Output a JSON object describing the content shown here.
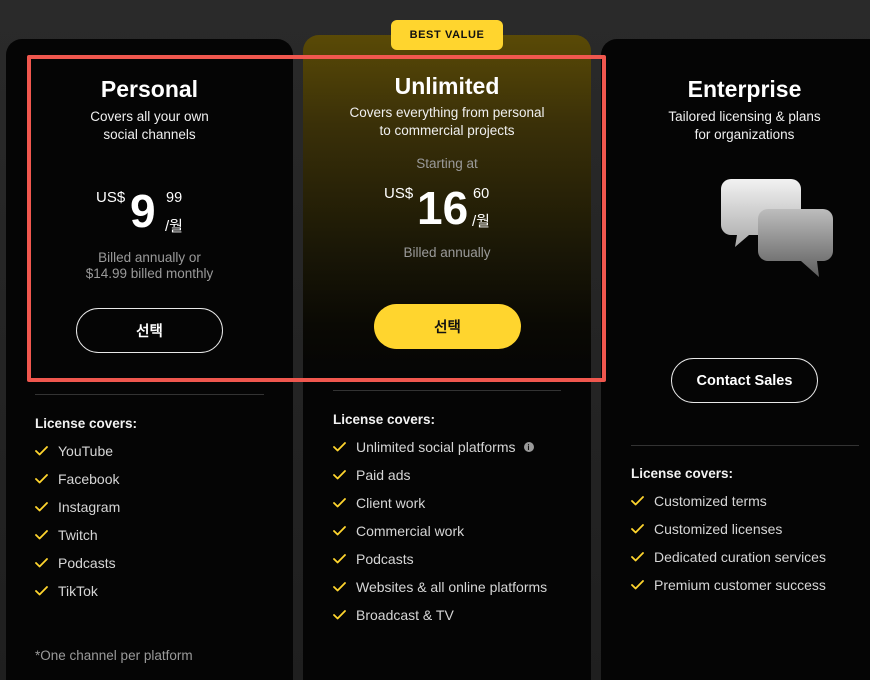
{
  "badge": "BEST VALUE",
  "personal": {
    "title": "Personal",
    "subtitle_line1": "Covers all your own",
    "subtitle_line2": "social channels",
    "currency": "US$",
    "price_whole": "9",
    "price_cents": "99",
    "per": "/월",
    "billing_line1": "Billed annually or",
    "billing_line2": "$14.99 billed monthly",
    "button": "선택",
    "covers_title": "License covers:",
    "features": [
      "YouTube",
      "Facebook",
      "Instagram",
      "Twitch",
      "Podcasts",
      "TikTok"
    ],
    "footnote": "*One channel per platform"
  },
  "unlimited": {
    "title": "Unlimited",
    "subtitle_line1": "Covers everything from personal",
    "subtitle_line2": "to commercial projects",
    "starting": "Starting at",
    "currency": "US$",
    "price_whole": "16",
    "price_cents": "60",
    "per": "/월",
    "billing": "Billed annually",
    "button": "선택",
    "covers_title": "License covers:",
    "features": [
      "Unlimited social platforms",
      "Paid ads",
      "Client work",
      "Commercial work",
      "Podcasts",
      "Websites & all online platforms",
      "Broadcast & TV"
    ]
  },
  "enterprise": {
    "title": "Enterprise",
    "subtitle_line1": "Tailored licensing & plans",
    "subtitle_line2": "for organizations",
    "illustration": "chat-bubbles-icon",
    "button": "Contact Sales",
    "covers_title": "License covers:",
    "features": [
      "Customized terms",
      "Customized licenses",
      "Dedicated curation services",
      "Premium customer success"
    ]
  },
  "colors": {
    "accent": "#ffd52e",
    "highlight": "#f0574e"
  }
}
